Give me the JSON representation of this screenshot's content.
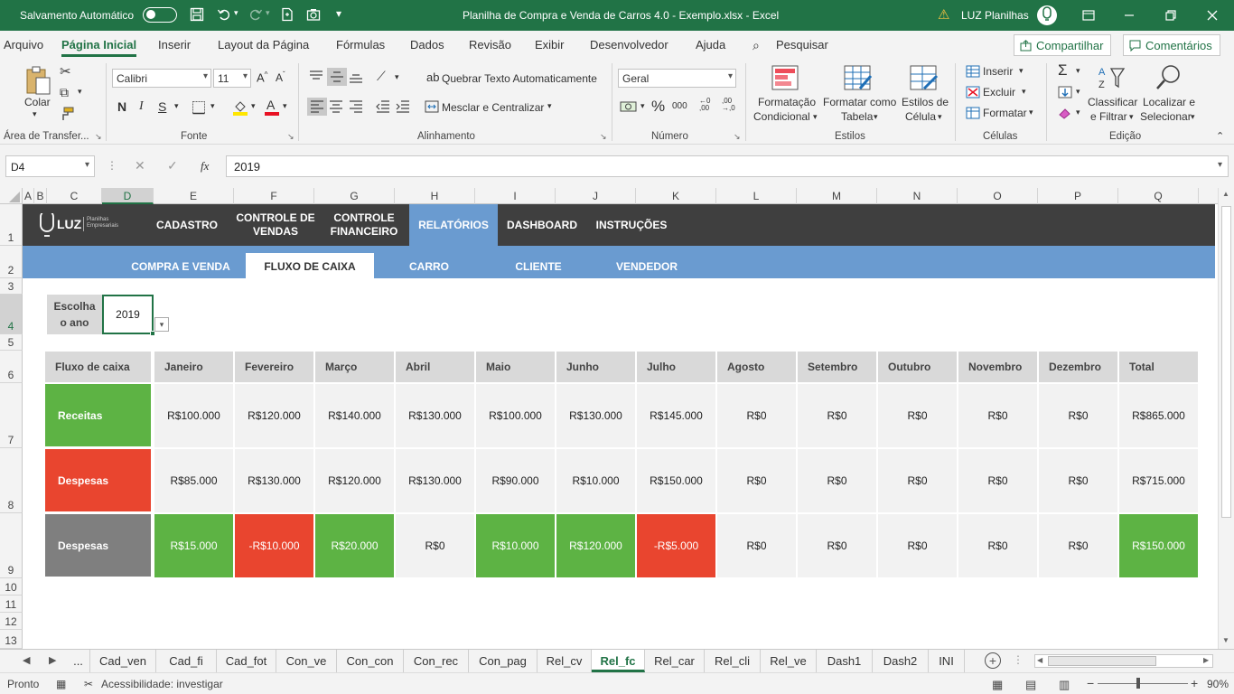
{
  "titlebar": {
    "autosave_label": "Salvamento Automático",
    "title": "Planilha de Compra e Venda de Carros 4.0 - Exemplo.xlsx  -  Excel",
    "user": "LUZ Planilhas",
    "bg": "#217346"
  },
  "menu": {
    "items": [
      "Arquivo",
      "Página Inicial",
      "Inserir",
      "Layout da Página",
      "Fórmulas",
      "Dados",
      "Revisão",
      "Exibir",
      "Desenvolvedor",
      "Ajuda"
    ],
    "search": "Pesquisar",
    "share": "Compartilhar",
    "comments": "Comentários"
  },
  "ribbon": {
    "clipboard": {
      "paste": "Colar",
      "group": "Área de Transfer..."
    },
    "font": {
      "name": "Calibri",
      "size": "11",
      "group": "Fonte"
    },
    "alignment": {
      "wrap": "Quebrar Texto Automaticamente",
      "merge": "Mesclar e Centralizar",
      "group": "Alinhamento"
    },
    "number": {
      "format": "Geral",
      "group": "Número"
    },
    "styles": {
      "cond1": "Formatação",
      "cond2": "Condicional",
      "table1": "Formatar como",
      "table2": "Tabela",
      "cell1": "Estilos de",
      "cell2": "Célula",
      "group": "Estilos"
    },
    "cells": {
      "insert": "Inserir",
      "delete": "Excluir",
      "format": "Formatar",
      "group": "Células"
    },
    "editing": {
      "sort1": "Classificar",
      "sort2": "e Filtrar",
      "find1": "Localizar e",
      "find2": "Selecionar",
      "group": "Edição"
    }
  },
  "formula_bar": {
    "name_box": "D4",
    "fx": "fx",
    "value": "2019"
  },
  "columns": [
    "A",
    "B",
    "C",
    "D",
    "E",
    "F",
    "G",
    "H",
    "I",
    "J",
    "K",
    "L",
    "M",
    "N",
    "O",
    "P",
    "Q"
  ],
  "rows": [
    "1",
    "2",
    "3",
    "4",
    "5",
    "6",
    "7",
    "8",
    "9",
    "10",
    "11",
    "12",
    "13"
  ],
  "sheet": {
    "logo": "LUZ",
    "logo_sub1": "Planilhas",
    "logo_sub2": "Empresariais",
    "nav": [
      "CADASTRO",
      "CONTROLE DE VENDAS",
      "CONTROLE FINANCEIRO",
      "RELATÓRIOS",
      "DASHBOARD",
      "INSTRUÇÕES"
    ],
    "subnav": [
      "COMPRA E VENDA",
      "FLUXO DE CAIXA",
      "CARRO",
      "CLIENTE",
      "VENDEDOR"
    ],
    "year_label_1": "Escolha",
    "year_label_2": "o ano",
    "year_value": "2019",
    "table": {
      "header_label": "Fluxo de caixa",
      "months": [
        "Janeiro",
        "Fevereiro",
        "Março",
        "Abril",
        "Maio",
        "Junho",
        "Julho",
        "Agosto",
        "Setembro",
        "Outubro",
        "Novembro",
        "Dezembro",
        "Total"
      ],
      "rows": [
        {
          "label": "Receitas",
          "values": [
            "R$100.000",
            "R$120.000",
            "R$140.000",
            "R$130.000",
            "R$100.000",
            "R$130.000",
            "R$145.000",
            "R$0",
            "R$0",
            "R$0",
            "R$0",
            "R$0",
            "R$865.000"
          ]
        },
        {
          "label": "Despesas",
          "values": [
            "R$85.000",
            "R$130.000",
            "R$120.000",
            "R$130.000",
            "R$90.000",
            "R$10.000",
            "R$150.000",
            "R$0",
            "R$0",
            "R$0",
            "R$0",
            "R$0",
            "R$715.000"
          ]
        },
        {
          "label": "Despesas",
          "values": [
            "R$15.000",
            "-R$10.000",
            "R$20.000",
            "R$0",
            "R$10.000",
            "R$120.000",
            "-R$5.000",
            "R$0",
            "R$0",
            "R$0",
            "R$0",
            "R$0",
            "R$150.000"
          ],
          "status": [
            "pos",
            "neg",
            "pos",
            "zero",
            "pos",
            "pos",
            "neg",
            "zero",
            "zero",
            "zero",
            "zero",
            "zero",
            "pos"
          ]
        }
      ]
    }
  },
  "colors": {
    "positive": "#5db344",
    "negative": "#e9452f",
    "neutral": "#7f7f7f",
    "nav": "#3f3f3f",
    "subnav": "#6a9bd0"
  },
  "tabs": [
    "...",
    "Cad_ven",
    "Cad_fi",
    "Cad_fot",
    "Con_ve",
    "Con_con",
    "Con_rec",
    "Con_pag",
    "Rel_cv",
    "Rel_fc",
    "Rel_car",
    "Rel_cli",
    "Rel_ve",
    "Dash1",
    "Dash2",
    "INI"
  ],
  "active_tab": "Rel_fc",
  "status": {
    "ready": "Pronto",
    "accessibility": "Acessibilidade: investigar",
    "zoom": "90%"
  }
}
